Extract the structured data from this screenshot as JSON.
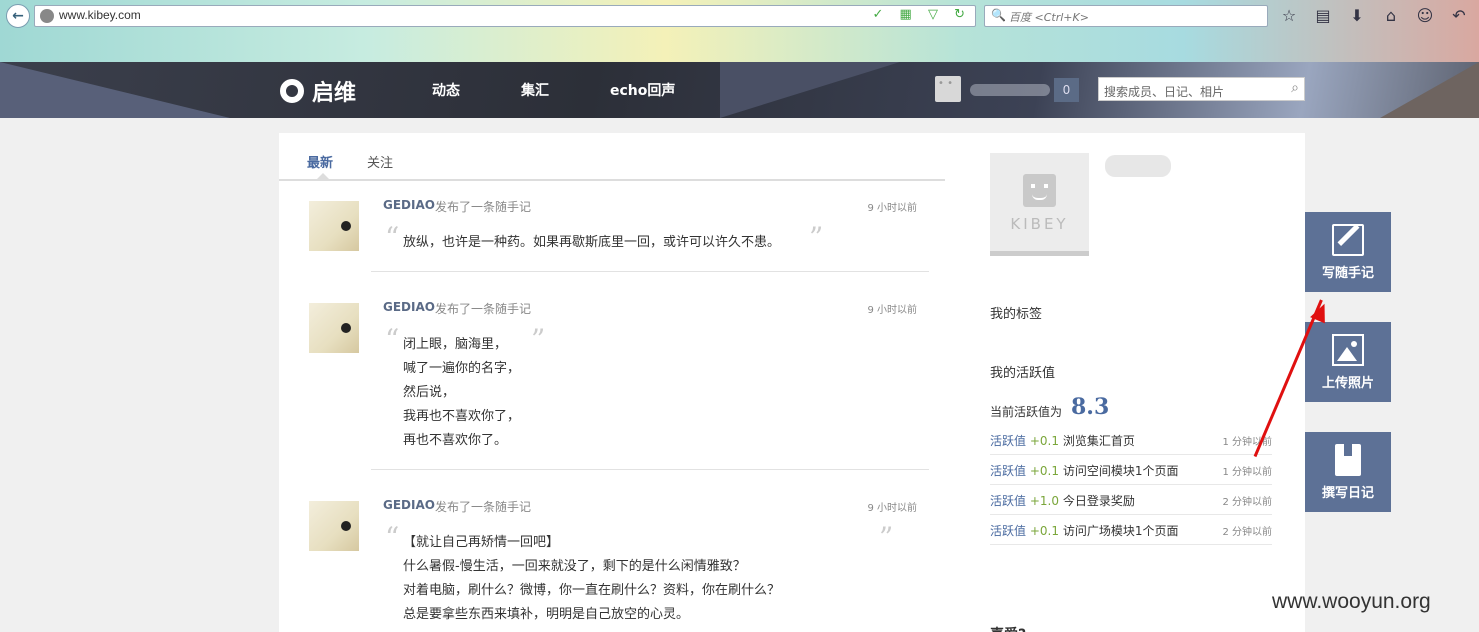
{
  "browser": {
    "back_glyph": "←",
    "url": "www.kibey.com",
    "url_tools": "✓ ▦ ▽ ↻",
    "search_glyph": "🔍",
    "search_placeholder": "百度 <Ctrl+K>",
    "icons": [
      "☆",
      "▤",
      "⬇",
      "⌂",
      "☺",
      "↶"
    ]
  },
  "header": {
    "logo_text": "启维",
    "nav": [
      "动态",
      "集汇",
      "echo回声"
    ],
    "notification_count": "0",
    "search_placeholder": "搜索成员、日记、相片",
    "search_glyph": "⌕"
  },
  "feed": {
    "tabs": [
      "最新",
      "关注"
    ],
    "quote_open": "“",
    "quote_close": "”",
    "posts": [
      {
        "author": "GEDIAO",
        "action": "发布了一条随手记",
        "time": "9 小时以前",
        "lines": [
          "放纵，也许是一种药。如果再歇斯底里一回，或许可以许久不患。"
        ]
      },
      {
        "author": "GEDIAO",
        "action": "发布了一条随手记",
        "time": "9 小时以前",
        "lines": [
          "闭上眼，脑海里，",
          "喊了一遍你的名字，",
          "然后说，",
          "我再也不喜欢你了，",
          "再也不喜欢你了。"
        ]
      },
      {
        "author": "GEDIAO",
        "action": "发布了一条随手记",
        "time": "9 小时以前",
        "lines": [
          "【就让自己再矫情一回吧】",
          "什么暑假-慢生活，一回来就没了，剩下的是什么闲情雅致？",
          "对着电脑，刷什么？微博，你一直在刷什么？资料，你在刷什么？",
          "总是要拿些东西来填补，明明是自己放空的心灵。"
        ]
      }
    ]
  },
  "sidebar": {
    "avatar_text": "KIBEY",
    "my_tags": "我的标签",
    "my_activity": "我的活跃值",
    "current_label": "当前活跃值为",
    "current_value": "8.3",
    "activity": [
      {
        "k": "活跃值",
        "plus": "+0.1",
        "desc": "浏览集汇首页",
        "time": "1 分钟以前"
      },
      {
        "k": "活跃值",
        "plus": "+0.1",
        "desc": "访问空间模块1个页面",
        "time": "1 分钟以前"
      },
      {
        "k": "活跃值",
        "plus": "+1.0",
        "desc": "今日登录奖励",
        "time": "2 分钟以前"
      },
      {
        "k": "活跃值",
        "plus": "+0.1",
        "desc": "访问广场模块1个页面",
        "time": "2 分钟以前"
      }
    ],
    "cut_heading": "喜爱?"
  },
  "actions": {
    "write_note": "写随手记",
    "upload_photo": "上传照片",
    "write_diary": "撰写日记"
  },
  "watermark": "www.wooyun.org"
}
